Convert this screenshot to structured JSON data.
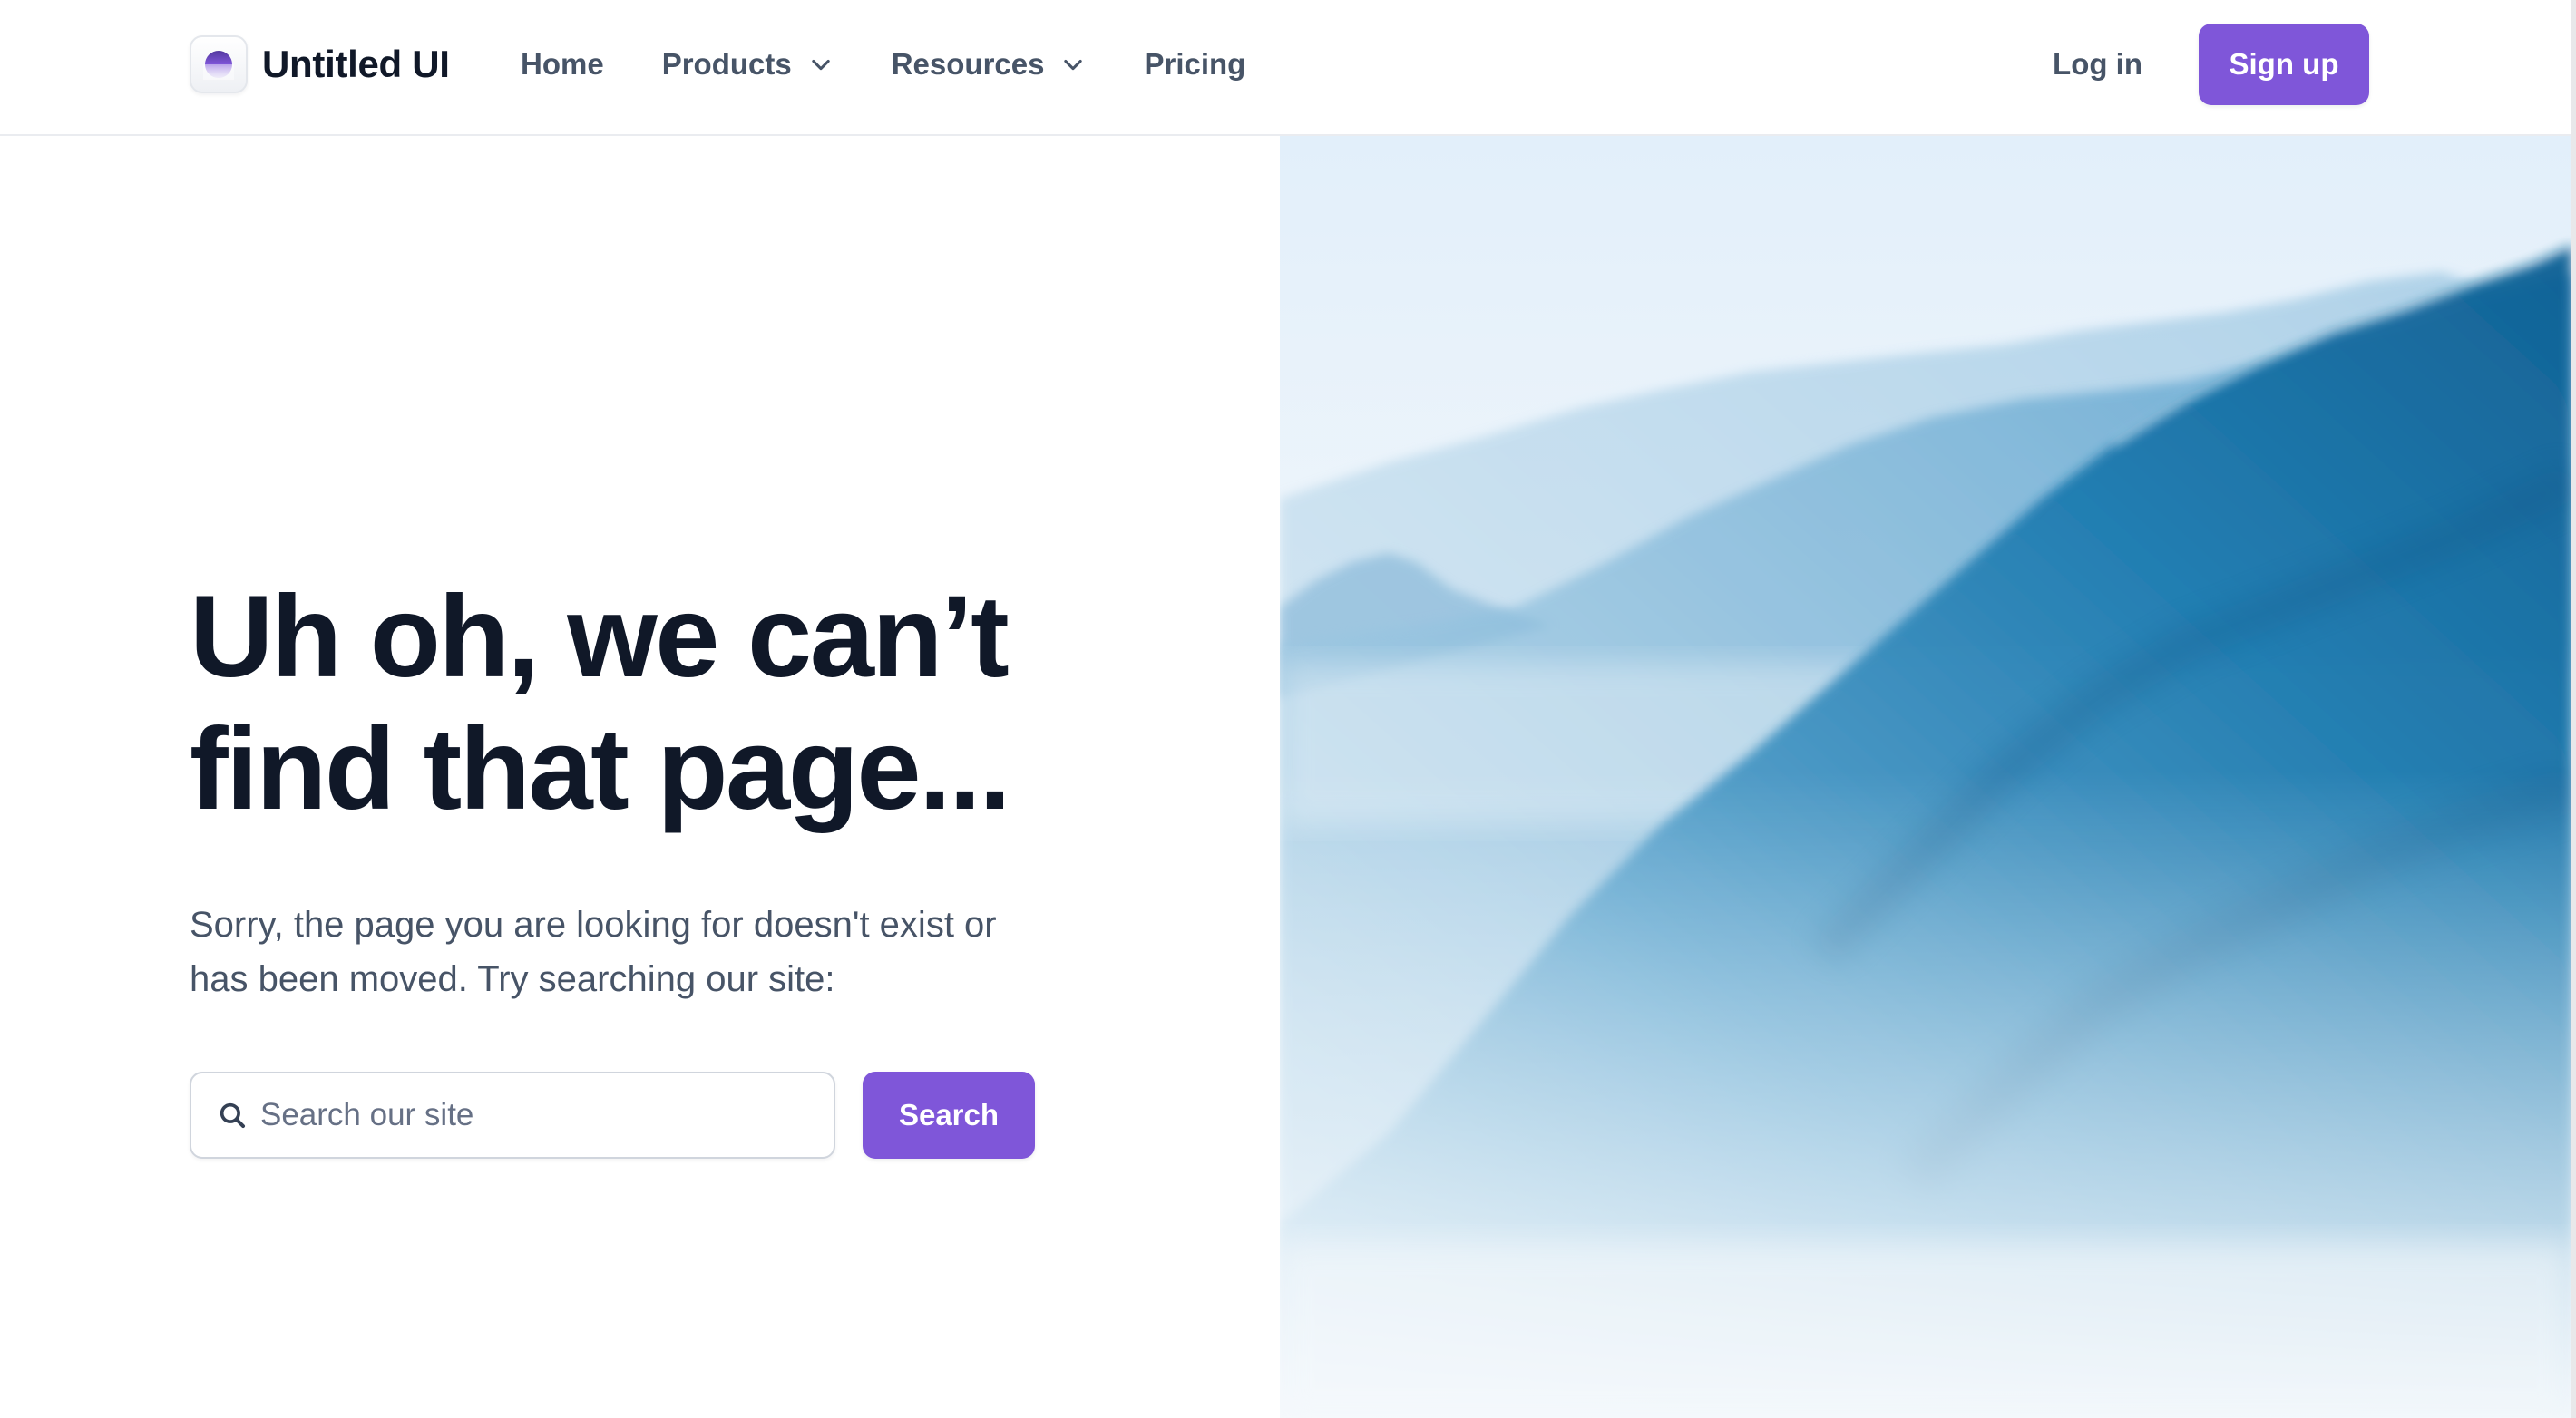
{
  "brand": {
    "name": "Untitled UI",
    "logo_icon": "untitled-ui-logo-icon"
  },
  "nav": {
    "links": [
      {
        "label": "Home",
        "has_dropdown": false
      },
      {
        "label": "Products",
        "has_dropdown": true,
        "icon": "chevron-down-icon"
      },
      {
        "label": "Resources",
        "has_dropdown": true,
        "icon": "chevron-down-icon"
      },
      {
        "label": "Pricing",
        "has_dropdown": false
      }
    ],
    "login_label": "Log in",
    "signup_label": "Sign up"
  },
  "hero": {
    "headline_lines": [
      "Uh oh, we can’t",
      "find that page..."
    ],
    "subtext_lines": [
      "Sorry, the page you are looking for doesn't exist or",
      "has been moved. Try searching our site:"
    ],
    "search": {
      "placeholder": "Search our site",
      "value": "",
      "icon": "search-icon",
      "button_label": "Search"
    }
  },
  "image": {
    "subject": "misty-blue-mountain-ridges-photo"
  },
  "colors": {
    "primary": "#7f56d9",
    "heading": "#101828",
    "body_text": "#475467",
    "placeholder": "#667085",
    "border": "#d0d5dd"
  }
}
